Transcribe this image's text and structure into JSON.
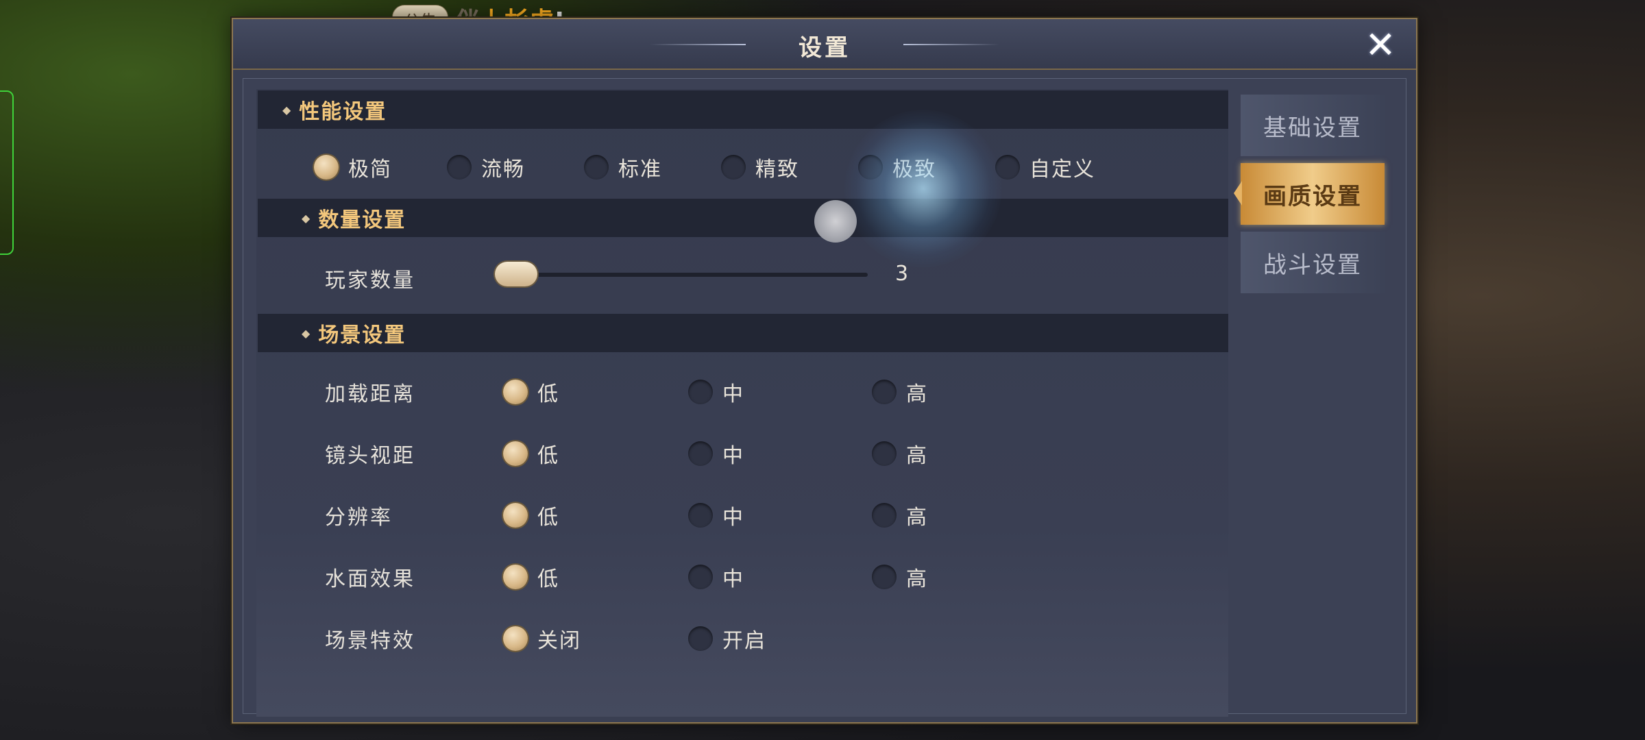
{
  "announcement": {
    "badge": "公告",
    "prefix": "伴",
    "name": "上杉虎",
    "suffix": "!"
  },
  "dialog": {
    "title": "设置",
    "close_icon": "close-icon"
  },
  "tabs": [
    {
      "label": "基础设置",
      "active": false
    },
    {
      "label": "画质设置",
      "active": true
    },
    {
      "label": "战斗设置",
      "active": false
    }
  ],
  "performance": {
    "title": "性能设置",
    "options": [
      "极简",
      "流畅",
      "标准",
      "精致",
      "极致",
      "自定义"
    ],
    "selected": "极简"
  },
  "quantity": {
    "title": "数量设置",
    "player_count": {
      "label": "玩家数量",
      "value": "3"
    }
  },
  "scene": {
    "title": "场景设置",
    "rows": [
      {
        "label": "加载距离",
        "options": [
          "低",
          "中",
          "高"
        ],
        "selected": "低"
      },
      {
        "label": "镜头视距",
        "options": [
          "低",
          "中",
          "高"
        ],
        "selected": "低"
      },
      {
        "label": "分辨率",
        "options": [
          "低",
          "中",
          "高"
        ],
        "selected": "低"
      },
      {
        "label": "水面效果",
        "options": [
          "低",
          "中",
          "高"
        ],
        "selected": "低"
      },
      {
        "label": "场景特效",
        "options": [
          "关闭",
          "开启"
        ],
        "selected": "关闭"
      }
    ]
  },
  "colors": {
    "accent_gold": "#f3c77c",
    "tab_active": "#f0cc8a",
    "panel_bg": "#3a3f52"
  }
}
